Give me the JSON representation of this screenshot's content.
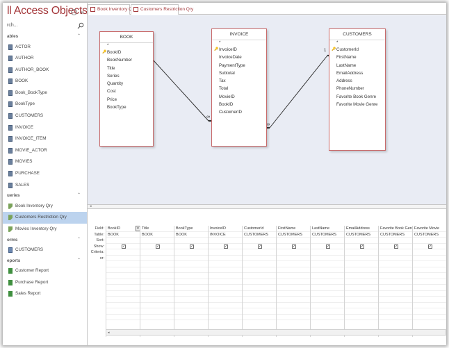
{
  "nav": {
    "title": "ll Access Objects",
    "search_text": "rch...",
    "groups": [
      {
        "label": "ables",
        "items": [
          {
            "label": "ACTOR",
            "icon": "table-icon"
          },
          {
            "label": "AUTHOR",
            "icon": "table-icon"
          },
          {
            "label": "AUTHOR_BOOK",
            "icon": "table-icon"
          },
          {
            "label": "BOOK",
            "icon": "table-icon"
          },
          {
            "label": "Book_BookType",
            "icon": "table-icon"
          },
          {
            "label": "BookType",
            "icon": "table-icon"
          },
          {
            "label": "CUSTOMERS",
            "icon": "table-icon"
          },
          {
            "label": "INVOICE",
            "icon": "table-icon"
          },
          {
            "label": "INVOICE_ITEM",
            "icon": "table-icon"
          },
          {
            "label": "MOVIE_ACTOR",
            "icon": "table-icon"
          },
          {
            "label": "MOVIES",
            "icon": "table-icon"
          },
          {
            "label": "PURCHASE",
            "icon": "table-icon"
          },
          {
            "label": "SALES",
            "icon": "table-icon"
          }
        ]
      },
      {
        "label": "ueries",
        "items": [
          {
            "label": "Book Inventory Qry",
            "icon": "query-icon"
          },
          {
            "label": "Customers Restriction Qry",
            "icon": "query-icon",
            "selected": true
          },
          {
            "label": "Movies Inventory Qry",
            "icon": "query-icon"
          }
        ]
      },
      {
        "label": "orms",
        "items": [
          {
            "label": "CUSTOMERS",
            "icon": "form-icon"
          }
        ]
      },
      {
        "label": "eports",
        "items": [
          {
            "label": "Customer Report",
            "icon": "report-icon"
          },
          {
            "label": "Purchase Report",
            "icon": "report-icon"
          },
          {
            "label": "Sales Report",
            "icon": "report-icon"
          }
        ]
      }
    ]
  },
  "tabs": [
    {
      "label": "Book Inventory Qry"
    },
    {
      "label": "Customers Restriction Qry",
      "active": true
    }
  ],
  "diagram": {
    "tables": [
      {
        "name": "BOOK",
        "fields": [
          "BookID",
          "BookNumber",
          "Title",
          "Series",
          "Quantity",
          "Cost",
          "Price",
          "BookType"
        ]
      },
      {
        "name": "INVOICE",
        "fields": [
          "InvoiceID",
          "InvoiceDate",
          "PaymentType",
          "Subtotal",
          "Tax",
          "Total",
          "MovieID",
          "BookID",
          "CustomerID"
        ]
      },
      {
        "name": "CUSTOMERS",
        "fields": [
          "CustomerId",
          "FirstName",
          "LastName",
          "EmailAddress",
          "Address",
          "PhoneNumber",
          "Favorite Book Genre",
          "Favorite Movie Genre"
        ]
      }
    ],
    "star": "*",
    "rel_one": "1",
    "rel_many": "∞"
  },
  "grid": {
    "row_labels": [
      "Field:",
      "Table:",
      "Sort:",
      "Show:",
      "Criteria:",
      "or:"
    ],
    "columns": [
      {
        "field": "BookID",
        "table": "BOOK"
      },
      {
        "field": "Title",
        "table": "BOOK"
      },
      {
        "field": "BookType",
        "table": "BOOK"
      },
      {
        "field": "InvoiceID",
        "table": "INVOICE"
      },
      {
        "field": "CustomerId",
        "table": "CUSTOMERS"
      },
      {
        "field": "FirstName",
        "table": "CUSTOMERS"
      },
      {
        "field": "LastName",
        "table": "CUSTOMERS"
      },
      {
        "field": "EmailAddress",
        "table": "CUSTOMERS"
      },
      {
        "field": "Favorite Book Genre",
        "table": "CUSTOMERS"
      },
      {
        "field": "Favorite Movie",
        "table": "CUSTOMERS"
      }
    ],
    "check_mark": "✓"
  }
}
